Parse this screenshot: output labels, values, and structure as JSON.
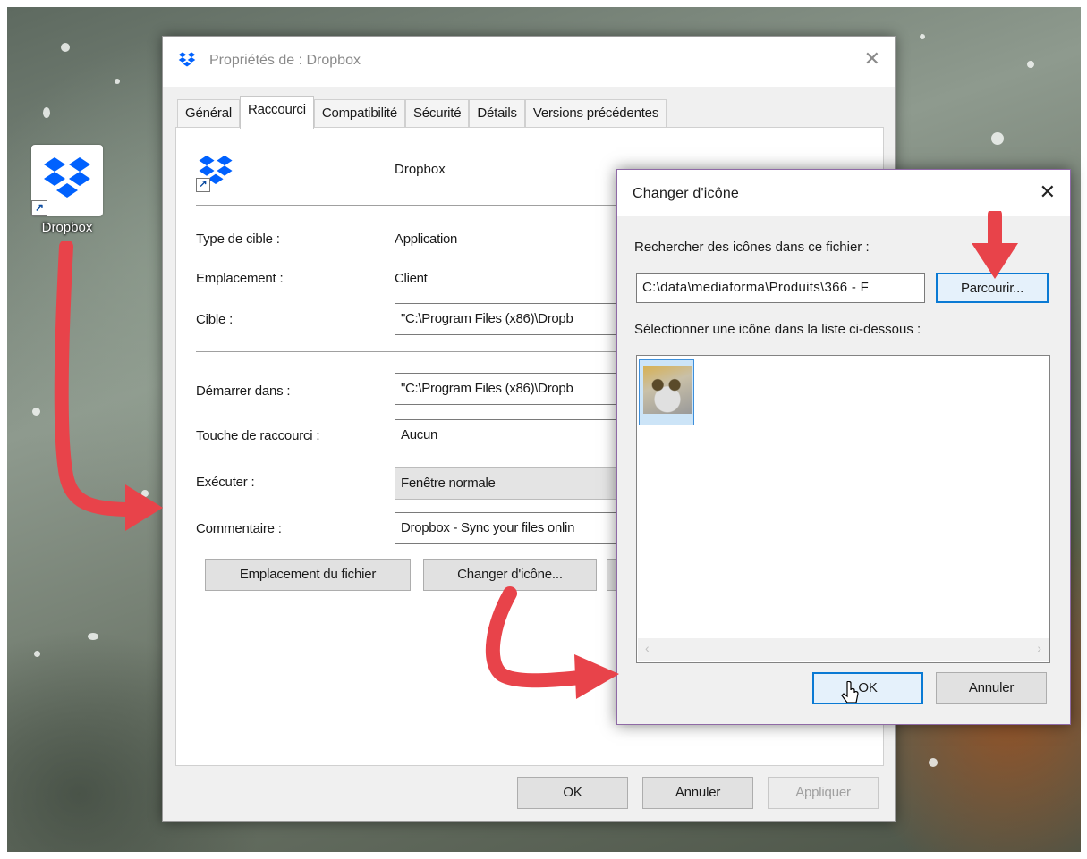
{
  "desktop": {
    "icon_label": "Dropbox"
  },
  "properties_dialog": {
    "title": "Propriétés de : Dropbox",
    "tabs": [
      "Général",
      "Raccourci",
      "Compatibilité",
      "Sécurité",
      "Détails",
      "Versions précédentes"
    ],
    "active_tab": "Raccourci",
    "shortcut_name": "Dropbox",
    "fields": {
      "target_type_label": "Type de cible :",
      "target_type_value": "Application",
      "location_label": "Emplacement :",
      "location_value": "Client",
      "target_label": "Cible :",
      "target_value": "\"C:\\Program Files (x86)\\Dropb",
      "start_in_label": "Démarrer dans :",
      "start_in_value": "\"C:\\Program Files (x86)\\Dropb",
      "shortcut_key_label": "Touche de raccourci :",
      "shortcut_key_value": "Aucun",
      "run_label": "Exécuter :",
      "run_value": "Fenêtre normale",
      "comment_label": "Commentaire :",
      "comment_value": "Dropbox - Sync your files onlin"
    },
    "buttons": {
      "open_location": "Emplacement du fichier",
      "change_icon": "Changer d'icône...",
      "ok": "OK",
      "cancel": "Annuler",
      "apply": "Appliquer"
    }
  },
  "change_icon_dialog": {
    "title": "Changer d'icône",
    "search_label": "Rechercher des icônes dans ce fichier :",
    "path_value": "C:\\data\\mediaforma\\Produits\\366 - F",
    "browse_button": "Parcourir...",
    "select_label": "Sélectionner une icône dans la liste ci-dessous :",
    "ok_button": "OK",
    "cancel_button": "Annuler"
  },
  "colors": {
    "dropbox_blue": "#0061fe",
    "annotation_red": "#e8434a",
    "focus_blue": "#0a7ad4"
  }
}
